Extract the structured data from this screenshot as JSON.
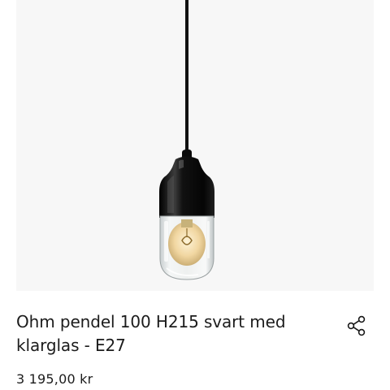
{
  "product": {
    "image_alt": "Ohm pendel 100 H215 svart med klarglas - E27",
    "title": "Ohm pendel 100 H215 svart med klarglas - E27",
    "price": "3 195,00 kr"
  },
  "actions": {
    "share_icon": "share-icon"
  },
  "colors": {
    "image_background": "#f7f7f7",
    "lamp_body": "#0b0b0b",
    "text": "#1c1c1c"
  }
}
